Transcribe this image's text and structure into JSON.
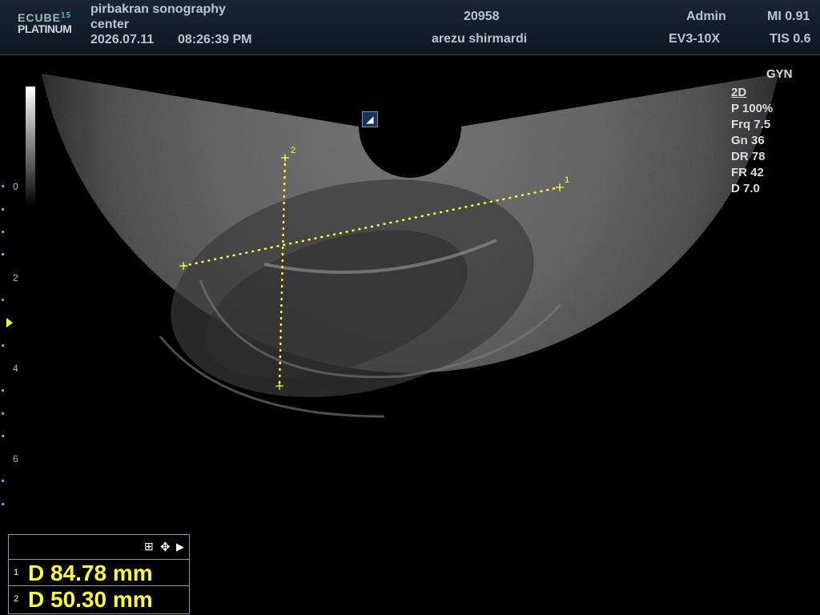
{
  "header": {
    "logo_line1": "ECUBE",
    "logo_sup": "15",
    "logo_line2": "PLATINUM",
    "center_line1": "pirbakran sonography",
    "center_line2": "center",
    "date": "2026.07.11",
    "time": "08:26:39  PM",
    "patient_id": "20958",
    "patient_name": "arezu shirmardi",
    "user": "Admin",
    "probe": "EV3-10X",
    "mi": "MI 0.91",
    "tis": "TIS 0.6"
  },
  "preset": "GYN",
  "params": {
    "mode": "2D",
    "power": "P 100%",
    "frequency": "Frq 7.5",
    "gain": "Gn 36",
    "dynamic_range": "DR 78",
    "frame_rate": "FR 42",
    "depth": "D 7.0"
  },
  "depth_scale": [
    "0",
    "2",
    "4",
    "6"
  ],
  "orientation_marker": "◢",
  "caliper_labels": [
    "1",
    "2"
  ],
  "measurements": [
    {
      "index": "1",
      "text": "D  84.78 mm"
    },
    {
      "index": "2",
      "text": "D  50.30 mm"
    }
  ],
  "colors": {
    "measurement": "#ffff33",
    "header_bg": "#132030"
  }
}
